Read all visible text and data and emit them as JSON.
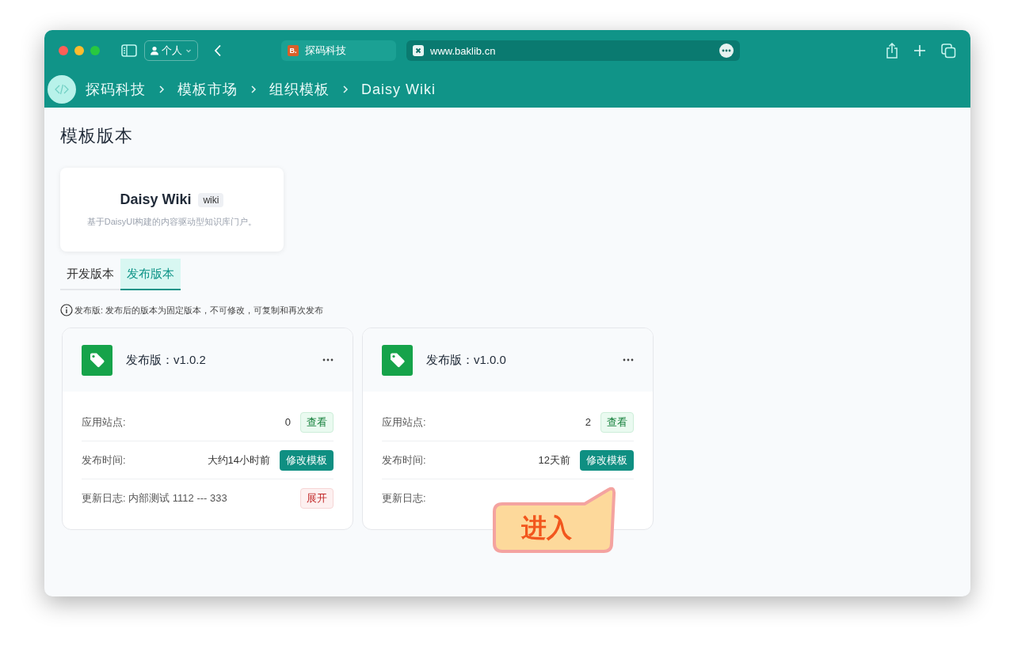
{
  "browser": {
    "profile": "个人",
    "tabs": [
      {
        "title": "探码科技",
        "favicon": "B.",
        "selected": false
      },
      {
        "title": "www.baklib.cn",
        "selected": true
      }
    ]
  },
  "breadcrumb": [
    "探码科技",
    "模板市场",
    "组织模板",
    "Daisy Wiki"
  ],
  "page_title": "模板版本",
  "template": {
    "name": "Daisy Wiki",
    "tag": "wiki",
    "description": "基于DaisyUI构建的内容驱动型知识库门户。"
  },
  "version_tabs": [
    {
      "label": "开发版本",
      "selected": false
    },
    {
      "label": "发布版本",
      "selected": true
    }
  ],
  "notice": "发布版: 发布后的版本为固定版本，不可修改，可复制和再次发布",
  "versions": [
    {
      "title": "发布版：v1.0.2",
      "rows": [
        {
          "kind": "count",
          "label": "应用站点:",
          "value": "0",
          "action": "查看"
        },
        {
          "kind": "time",
          "label": "发布时间:",
          "value": "大约14小时前",
          "action": "修改模板"
        },
        {
          "kind": "log",
          "label": "更新日志: 内部测试 1112 --- 333",
          "action": "展开"
        }
      ]
    },
    {
      "title": "发布版：v1.0.0",
      "rows": [
        {
          "kind": "count",
          "label": "应用站点:",
          "value": "2",
          "action": "查看"
        },
        {
          "kind": "time",
          "label": "发布时间:",
          "value": "12天前",
          "action": "修改模板"
        },
        {
          "kind": "log",
          "label": "更新日志:"
        }
      ]
    }
  ],
  "callout": {
    "text": "进入"
  }
}
